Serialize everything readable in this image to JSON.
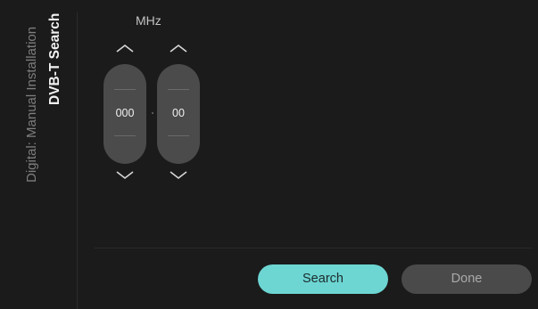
{
  "sidebar": {
    "subtitle": "Digital: Manual Installation",
    "title": "DVB-T Search"
  },
  "frequency": {
    "unit": "MHz",
    "major": "000",
    "minor": "00"
  },
  "buttons": {
    "search_label": "Search",
    "done_label": "Done"
  },
  "colors": {
    "background": "#1b1b1b",
    "accent": "#6dd6d3",
    "pill": "#4b4b4b",
    "inactive_button": "#4a4a4a"
  },
  "icons": {
    "up": "chevron-up-icon",
    "down": "chevron-down-icon"
  }
}
